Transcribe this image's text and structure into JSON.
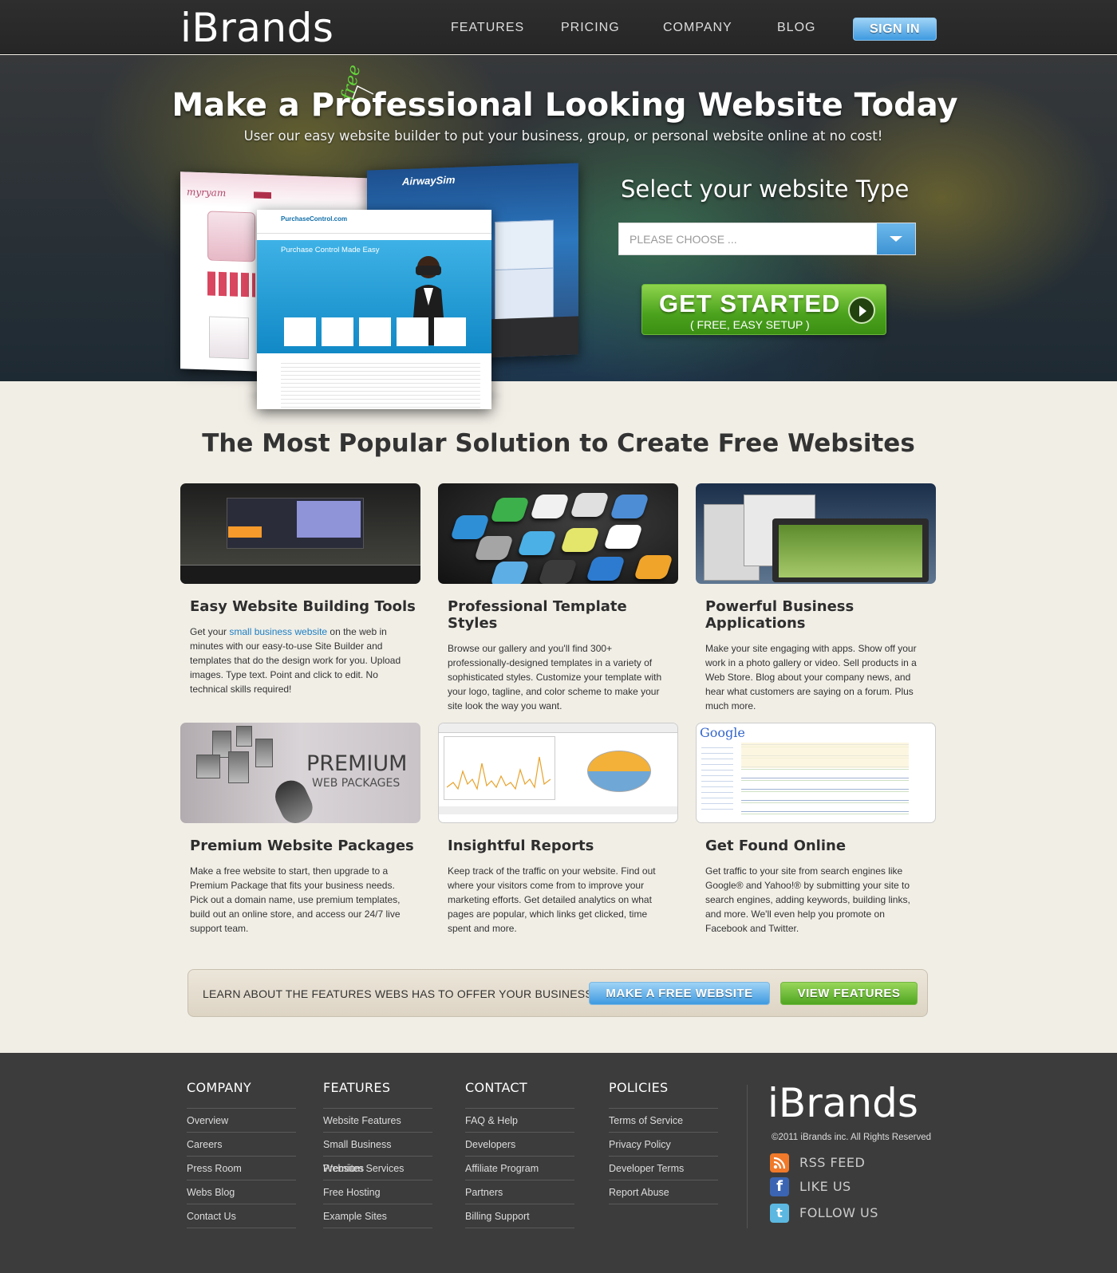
{
  "header": {
    "logo": "iBrands",
    "nav": [
      "FEATURES",
      "PRICING",
      "COMPANY",
      "BLOG"
    ],
    "signin": "SIGN IN"
  },
  "hero": {
    "free_word": "free",
    "title": "Make a Professional Looking Website Today",
    "subtitle": "User our easy website builder to put your business, group, or personal website online at no cost!",
    "select_title": "Select your website Type",
    "select_placeholder": "PLEASE CHOOSE ...",
    "cta_main": "GET STARTED",
    "cta_sub": "( FREE, EASY SETUP )",
    "screenshots": {
      "myryam_brand": "myryam",
      "airway_brand": "AirwaySim",
      "purchase_brand": "PurchaseControl.com",
      "purchase_heading": "Purchase Control Made Easy"
    }
  },
  "main": {
    "section_title": "The Most Popular Solution to Create Free Websites",
    "features": [
      {
        "title": "Easy Website Building Tools",
        "text_pre": "Get your ",
        "link": "small business website",
        "text_post": " on the web in minutes with our easy-to-use Site Builder and templates that do the design work for you. Upload images. Type text. Point and click to edit. No technical skills required!"
      },
      {
        "title": "Professional Template Styles",
        "text": "Browse our gallery and you'll find 300+ professionally-designed templates in a variety of sophisticated styles. Customize your template with your logo, tagline, and color scheme to make your site look the way you want."
      },
      {
        "title": "Powerful Business Applications",
        "text": "Make your site engaging with apps. Show off your work in a photo gallery or video. Sell products in a Web Store. Blog about your company news, and hear what customers are saying on a forum. Plus much more."
      },
      {
        "title": "Premium Website Packages",
        "text": "Make a free website to start, then upgrade to a Premium Package that fits your business needs. Pick out a domain name, use premium templates, build out an online store, and access our 24/7 live support team.",
        "thumb_line1": "PREMIUM",
        "thumb_line2": "WEB PACKAGES"
      },
      {
        "title": "Insightful Reports",
        "text": "Keep track of the traffic on your website. Find out where your visitors come from to improve your marketing efforts. Get detailed analytics on what pages are popular, which links get clicked, time spent and more."
      },
      {
        "title": "Get Found Online",
        "text": "Get traffic to your site from search engines like Google® and Yahoo!® by submitting your site to search engines, adding keywords, building links, and more. We'll even help you promote on Facebook and Twitter.",
        "thumb_logo": "Google"
      }
    ],
    "cta_bar": {
      "text": "LEARN ABOUT THE FEATURES WEBS HAS TO OFFER YOUR BUSINESS!",
      "btn1": "MAKE A FREE WEBSITE",
      "btn2": "VIEW FEATURES"
    }
  },
  "footer": {
    "columns": [
      {
        "heading": "COMPANY",
        "links": [
          "Overview",
          "Careers",
          "Press Room",
          "Webs Blog",
          "Contact Us"
        ]
      },
      {
        "heading": "FEATURES",
        "links": [
          "Website Features",
          "Small Business Websites",
          "Premium Services",
          "Free Hosting",
          "Example Sites"
        ]
      },
      {
        "heading": "CONTACT",
        "links": [
          "FAQ & Help",
          "Developers",
          "Affiliate Program",
          "Partners",
          "Billing Support"
        ]
      },
      {
        "heading": "POLICIES",
        "links": [
          "Terms of Service",
          "Privacy Policy",
          "Developer Terms",
          "Report Abuse"
        ]
      }
    ],
    "logo": "iBrands",
    "copyright": "©2011 iBrands inc. All Rights Reserved",
    "social": [
      {
        "icon": "rss-icon",
        "label": "RSS FEED",
        "color": "#f0792a"
      },
      {
        "icon": "facebook-icon",
        "label": "LIKE US",
        "color": "#3b65b3"
      },
      {
        "icon": "twitter-icon",
        "label": "FOLLOW US",
        "color": "#5cb8e0"
      }
    ]
  }
}
